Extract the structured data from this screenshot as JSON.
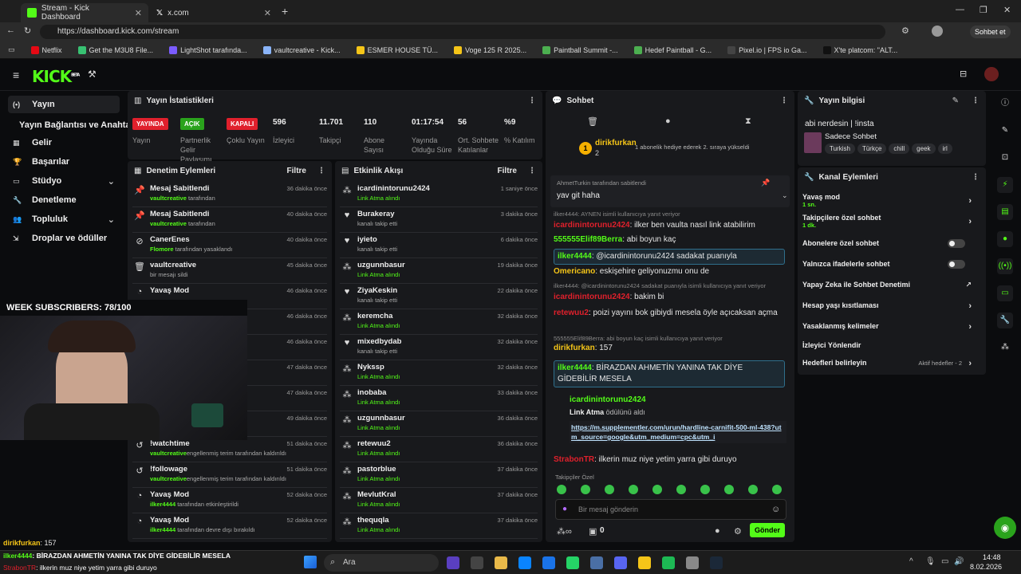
{
  "browser": {
    "tabs": [
      {
        "title": "Stream - Kick Dashboard"
      },
      {
        "title": "x.com"
      }
    ],
    "url": "https://dashboard.kick.com/stream",
    "profile_btn": "Sohbet et",
    "bookmarks": [
      "Netflix",
      "Get the M3U8 File...",
      "LightShot tarafında...",
      "vaultcreative - Kick...",
      "ESMER HOUSE TÜ...",
      "Voge 125 R 2025...",
      "Paintball Summit -...",
      "Hedef Paintball - G...",
      "Pixel.io | FPS io Ga...",
      "X'te platcom: \"ALT..."
    ],
    "bookmark_colors": [
      "#e50914",
      "#38c172",
      "#7b5cff",
      "#8ab4f8",
      "#f5c518",
      "#f5c518",
      "#4caf50",
      "#4caf50",
      "#444",
      "#111"
    ]
  },
  "app": {
    "logo": "KICK",
    "logo_sup": "BETA"
  },
  "sidebar": {
    "items": [
      {
        "label": "Yayın",
        "icon": "broadcast-icon"
      },
      {
        "label": "Yayın Bağlantısı ve Anahtarı",
        "icon": ""
      },
      {
        "label": "Gelir",
        "icon": "money-icon"
      },
      {
        "label": "Başarılar",
        "icon": "trophy-icon"
      },
      {
        "label": "Stüdyo",
        "icon": "studio-icon"
      },
      {
        "label": "Denetleme",
        "icon": "moderation-icon"
      },
      {
        "label": "Topluluk",
        "icon": "community-icon"
      },
      {
        "label": "Droplar ve ödüller",
        "icon": "drops-icon"
      }
    ]
  },
  "stats": {
    "title": "Yayın İstatistikleri",
    "items": [
      {
        "badge": "YAYINDA",
        "label": "Yayın",
        "color": "#e0202c"
      },
      {
        "badge": "AÇIK",
        "label": "Partnerlik Gelir Paylaşımı",
        "color": "#2aa31c"
      },
      {
        "badge": "KAPALI",
        "label": "Çoklu Yayın",
        "color": "#e0202c"
      },
      {
        "value": "596",
        "label": "İzleyici"
      },
      {
        "value": "11.701",
        "label": "Takipçi"
      },
      {
        "value": "110",
        "label": "Abone Sayısı"
      },
      {
        "value": "01:17:54",
        "label": "Yayında Olduğu Süre"
      },
      {
        "value": "56",
        "label": "Ort. Sohbete Katılanlar"
      },
      {
        "value": "%9",
        "label": "% Katılım"
      }
    ]
  },
  "mod": {
    "title": "Denetim Eylemleri",
    "filter": "Filtre",
    "rows": [
      {
        "icon": "pin-icon",
        "t1": "Mesaj Sabitlendi",
        "u": "vaultcreative",
        "t2": " tarafından",
        "time": "36 dakika önce"
      },
      {
        "icon": "pin-icon",
        "t1": "Mesaj Sabitlendi",
        "u": "vaultcreative",
        "t2": " tarafından",
        "time": "40 dakika önce"
      },
      {
        "icon": "ban-icon",
        "t1": "CanerEnes",
        "u": "Flomore",
        "t2": " tarafından yasaklandı",
        "time": "40 dakika önce"
      },
      {
        "icon": "trash-icon",
        "t1": "vaultcreative",
        "u": "",
        "t2": "bir mesajı sildi",
        "time": "45 dakika önce"
      },
      {
        "icon": "slow-icon",
        "t1": "Yavaş Mod",
        "u": "",
        "t2": "",
        "time": "46 dakika önce"
      },
      {
        "icon": "slow-icon",
        "t1": "",
        "u": "",
        "t2": "",
        "time": "46 dakika önce"
      },
      {
        "icon": "slow-icon",
        "t1": "",
        "u": "",
        "t2": "kıldı",
        "time": "46 dakika önce"
      },
      {
        "icon": "slow-icon",
        "t1": "",
        "u": "",
        "t2": "",
        "time": "47 dakika önce"
      },
      {
        "icon": "slow-icon",
        "t1": "",
        "u": "",
        "t2": "",
        "time": "47 dakika önce"
      },
      {
        "icon": "slow-icon",
        "t1": "",
        "u": "",
        "t2": "",
        "time": "49 dakika önce"
      },
      {
        "icon": "undo-icon",
        "t1": "!watchtime",
        "u": "vaultcreative",
        "t2": "engellenmiş terim  tarafından kaldırıldı",
        "time": "51 dakika önce"
      },
      {
        "icon": "undo-icon",
        "t1": "!followage",
        "u": "vaultcreative",
        "t2": "engellenmiş terim  tarafından kaldırıldı",
        "time": "51 dakika önce"
      },
      {
        "icon": "slow-icon",
        "t1": "Yavaş Mod",
        "u": "ilker4444",
        "t2": " tarafından etkinleştirildi",
        "time": "52 dakika önce"
      },
      {
        "icon": "slow-icon",
        "t1": "Yavaş Mod",
        "u": "ilker4444",
        "t2": " tarafından devre dışı bırakıldı",
        "time": "52 dakika önce"
      }
    ]
  },
  "activity": {
    "title": "Etkinlik Akışı",
    "filter": "Filtre",
    "rows": [
      {
        "icon": "link-icon",
        "t1": "icardinintorunu2424",
        "t2": "Link Atma alındı",
        "time": "1 saniye önce"
      },
      {
        "icon": "heart-icon",
        "t1": "Burakeray",
        "t2": "kanalı takip etti",
        "time": "3 dakika önce"
      },
      {
        "icon": "heart-icon",
        "t1": "iyieto",
        "t2": "kanalı takip etti",
        "time": "6 dakika önce"
      },
      {
        "icon": "link-icon",
        "t1": "uzgunnbasur",
        "t2": "Link Atma alındı",
        "time": "19 dakika önce"
      },
      {
        "icon": "heart-icon",
        "t1": "ZiyaKeskin",
        "t2": "kanalı takip etti",
        "time": "22 dakika önce"
      },
      {
        "icon": "link-icon",
        "t1": "keremcha",
        "t2": "Link Atma alındı",
        "time": "32 dakika önce"
      },
      {
        "icon": "heart-icon",
        "t1": "mixedbydab",
        "t2": "kanalı takip etti",
        "time": "32 dakika önce"
      },
      {
        "icon": "link-icon",
        "t1": "Nykssp",
        "t2": "Link Atma alındı",
        "time": "32 dakika önce"
      },
      {
        "icon": "link-icon",
        "t1": "inobaba",
        "t2": "Link Atma alındı",
        "time": "33 dakika önce"
      },
      {
        "icon": "link-icon",
        "t1": "uzgunnbasur",
        "t2": "Link Atma alındı",
        "time": "36 dakika önce"
      },
      {
        "icon": "link-icon",
        "t1": "retewuu2",
        "t2": "Link Atma alındı",
        "time": "36 dakika önce"
      },
      {
        "icon": "link-icon",
        "t1": "pastorblue",
        "t2": "Link Atma alındı",
        "time": "37 dakika önce"
      },
      {
        "icon": "link-icon",
        "t1": "MevlutKral",
        "t2": "Link Atma alındı",
        "time": "37 dakika önce"
      },
      {
        "icon": "link-icon",
        "t1": "thequqla",
        "t2": "Link Atma alındı",
        "time": "37 dakika önce"
      }
    ]
  },
  "chat": {
    "title": "Sohbet",
    "gift_user": "dirikfurkan",
    "gift_count": "2",
    "gift_text": "1 abonelik hediye ederek 2. sıraya yükseldi",
    "pinned_by": "AhmetTurkin tarafından sabitlendi",
    "pinned_text": "yav git haha",
    "messages": [
      {
        "type": "reply",
        "text": "ilker4444: AYNEN isimli kullanıcıya yanıt veriyor"
      },
      {
        "user": "icardinintorunu2424",
        "color": "#e0202c",
        "text": ": ilker ben vaulta nasıl link atabilirim"
      },
      {
        "user": "555555Elif89Berra",
        "color": "#53fc18",
        "text": ": abi boyun kaç"
      },
      {
        "user": "ilker4444",
        "color": "#53fc18",
        "text": ": @icardinintorunu2424 sadakat puanıyla",
        "hl": true
      },
      {
        "user": "Omericano",
        "color": "#f5c518",
        "text": ": eskişehire geliyonuzmu onu de"
      },
      {
        "type": "reply",
        "text": "ilker4444: @icardinintorunu2424 sadakat puanıyla isimli kullanıcıya yanıt veriyor"
      },
      {
        "user": "icardinintorunu2424",
        "color": "#e0202c",
        "text": ": bakim bi"
      },
      {
        "user": "retewuu2",
        "color": "#e0202c",
        "text": ": poizi yayını bok gibiydi mesela öyle açıcaksan açma"
      },
      {
        "type": "reply",
        "text": "555555Elif89Berra: abi boyun kaç isimli kullanıcıya yanıt veriyor"
      },
      {
        "user": "dirikfurkan",
        "color": "#f5c518",
        "text": ": 157"
      },
      {
        "user": "ilker4444",
        "color": "#53fc18",
        "text": ": BİRAZDAN AHMETİN YANINA TAK DİYE GİDEBİLİR MESELA",
        "hl": true
      }
    ],
    "redeem_user": "icardinintorunu2424",
    "redeem_title": "Link Atma",
    "redeem_suffix": " ödülünü aldı",
    "redeem_link": "https://m.supplementler.com/urun/hardline-carnifit-500-ml-438?utm_source=google&utm_medium=cpc&utm_i",
    "last_user": "StrabonTR",
    "last_text": ": ilkerin muz niye yetim yarra gibi duruyo",
    "followers_only": "Takipçiler Özel",
    "input_placeholder": "Bir mesaj gönderin",
    "points": "0",
    "send": "Gönder"
  },
  "info": {
    "title": "Yayın bilgisi",
    "stream_title": "abi nerdesin | !insta",
    "category": "Sadece Sohbet",
    "tags": [
      "Turkish",
      "Türkçe",
      "chill",
      "geek",
      "irl"
    ]
  },
  "channel": {
    "title": "Kanal Eylemleri",
    "actions": [
      {
        "label": "Yavaş mod",
        "sub": "1 sn.",
        "ctrl": "chevron"
      },
      {
        "label": "Takipçilere özel sohbet",
        "sub": "1 dk.",
        "ctrl": "chevron"
      },
      {
        "label": "Abonelere özel sohbet",
        "ctrl": "toggle"
      },
      {
        "label": "Yalnızca ifadelerle sohbet",
        "ctrl": "toggle"
      },
      {
        "label": "Yapay Zeka ile Sohbet Denetimi",
        "ctrl": "ext"
      },
      {
        "label": "Hesap yaşı kısıtlaması",
        "ctrl": "chevron"
      },
      {
        "label": "Yasaklanmış kelimeler",
        "ctrl": "chevron"
      },
      {
        "label": "İzleyici Yönlendir",
        "ctrl": ""
      },
      {
        "label": "Hedefleri belirleyin",
        "ctrl": "chevron",
        "extra": "Aktif hedefler - 2"
      }
    ]
  },
  "overlay": {
    "subs": "WEEK SUBSCRIBERS: 78/100",
    "last_chat_user": "dirikfurkan",
    "last_chat_text": ": 157",
    "ticker_user": "ilker4444",
    "ticker_text": ": BİRAZDAN AHMETİN YANINA TAK DİYE GİDEBİLİR MESELA",
    "ticker2_user": "StrabonTR",
    "ticker2_text": ": ilkerin muz niye yetim yarra gibi duruyo"
  },
  "taskbar": {
    "search": "Ara",
    "time": "14:48",
    "date": "8.02.2026"
  }
}
